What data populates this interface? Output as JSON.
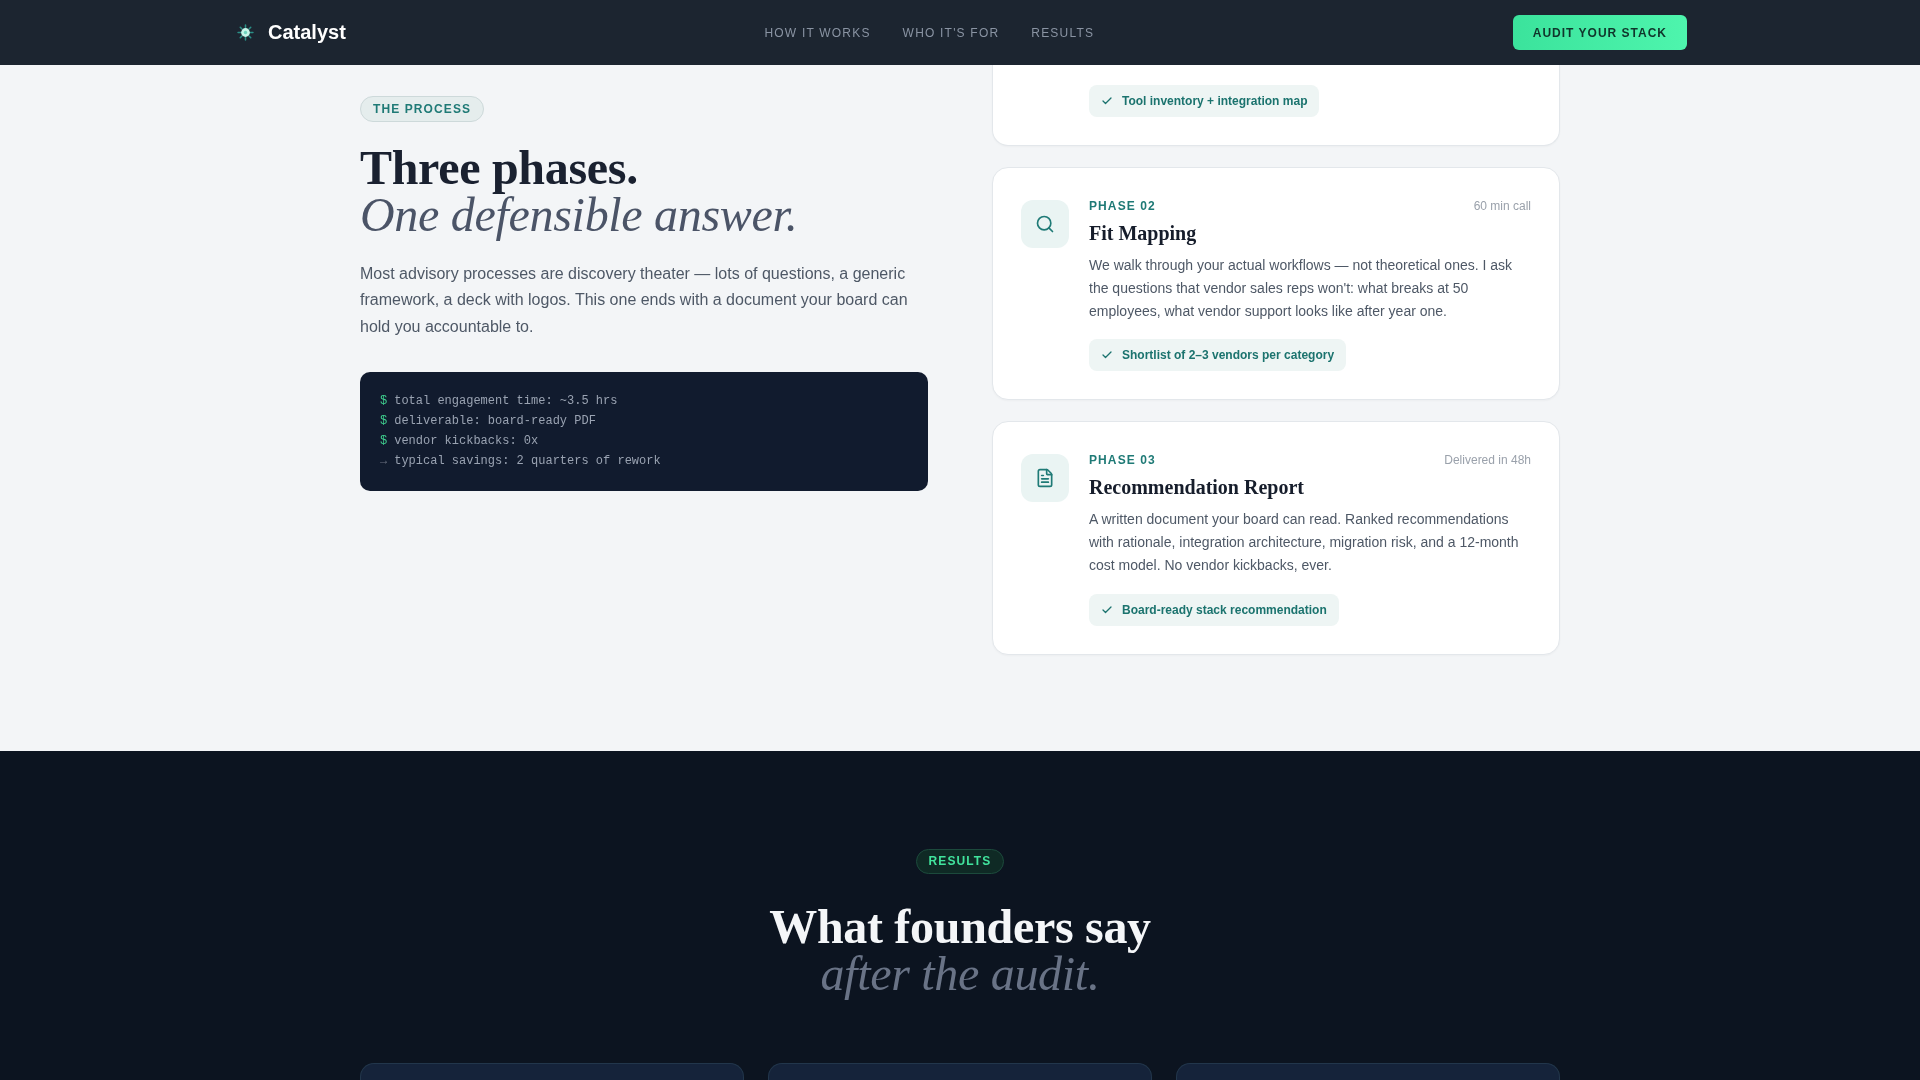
{
  "nav": {
    "brand": "Catalyst",
    "links": [
      "HOW IT WORKS",
      "WHO IT'S FOR",
      "RESULTS"
    ],
    "cta": "AUDIT YOUR STACK"
  },
  "process": {
    "tag": "THE PROCESS",
    "title": "Three phases.",
    "subtitle": "One defensible answer.",
    "intro": "Most advisory processes are discovery theater — lots of questions, a generic framework, a deck with logos. This one ends with a document your board can hold you accountable to.",
    "terminal": [
      {
        "kind": "command",
        "prompt": "$",
        "text": "total engagement time: ~3.5 hrs"
      },
      {
        "kind": "command",
        "prompt": "$",
        "text": "deliverable: board-ready PDF"
      },
      {
        "kind": "command",
        "prompt": "$",
        "text": "vendor kickbacks: 0x"
      },
      {
        "kind": "result",
        "prompt": "→",
        "text": "typical savings: 2 quarters of rework"
      }
    ],
    "phases": [
      {
        "kind": "clipped",
        "deliverable": "Tool inventory + integration map"
      },
      {
        "kind": "full",
        "label": "PHASE 02",
        "duration": "60 min call",
        "title": "Fit Mapping",
        "description": "We walk through your actual workflows — not theoretical ones. I ask the questions that vendor sales reps won't: what breaks at 50 employees, what vendor support looks like after year one.",
        "deliverable": "Shortlist of 2–3 vendors per category"
      },
      {
        "kind": "full",
        "label": "PHASE 03",
        "duration": "Delivered in 48h",
        "title": "Recommendation Report",
        "description": "A written document your board can read. Ranked recommendations with rationale, integration architecture, migration risk, and a 12-month cost model. No vendor kickbacks, ever.",
        "deliverable": "Board-ready stack recommendation"
      }
    ]
  },
  "results": {
    "tag": "RESULTS",
    "title": "What founders say",
    "subtitle": "after the audit.",
    "testimonials": [
      {
        "kind": "clipped"
      },
      {
        "kind": "clipped"
      },
      {
        "kind": "clipped"
      }
    ]
  }
}
